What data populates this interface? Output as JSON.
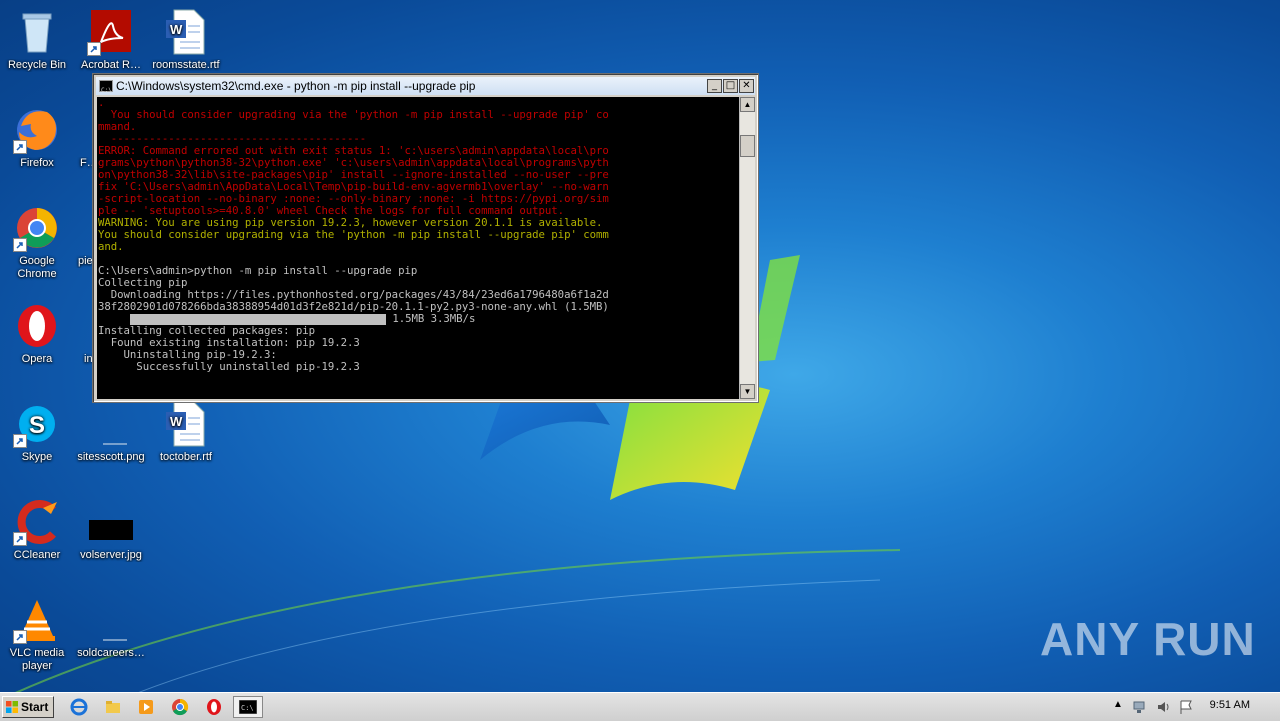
{
  "desktop": {
    "icons": [
      {
        "label": "Recycle Bin",
        "icon": "recycle-bin-icon"
      },
      {
        "label": "Acrobat R…",
        "icon": "acrobat-icon"
      },
      {
        "label": "roomsstate.rtf",
        "icon": "word-doc-icon"
      },
      {
        "label": "Firefox",
        "icon": "firefox-icon"
      },
      {
        "label": "File",
        "icon": "file-icon"
      },
      {
        "label": "Google Chrome",
        "icon": "chrome-icon"
      },
      {
        "label": "pie",
        "icon": "file-icon"
      },
      {
        "label": "Opera",
        "icon": "opera-icon"
      },
      {
        "label": "in",
        "icon": "file-icon"
      },
      {
        "label": "Skype",
        "icon": "skype-icon"
      },
      {
        "label": "sitesscott.png",
        "icon": "image-file-icon"
      },
      {
        "label": "toctober.rtf",
        "icon": "word-doc-icon"
      },
      {
        "label": "CCleaner",
        "icon": "ccleaner-icon"
      },
      {
        "label": "volserver.jpg",
        "icon": "image-file-icon"
      },
      {
        "label": "VLC media player",
        "icon": "vlc-icon"
      },
      {
        "label": "soldcareers…",
        "icon": "image-file-icon"
      }
    ]
  },
  "cmd": {
    "title": "C:\\Windows\\system32\\cmd.exe - python  -m pip install --upgrade pip",
    "lines_red": [
      "  You should consider upgrading via the 'python -m pip install --upgrade pip' co",
      "mmand.",
      "  ----------------------------------------",
      "ERROR: Command errored out with exit status 1: 'c:\\users\\admin\\appdata\\local\\pro",
      "grams\\python\\python38-32\\python.exe' 'c:\\users\\admin\\appdata\\local\\programs\\pyth",
      "on\\python38-32\\lib\\site-packages\\pip' install --ignore-installed --no-user --pre",
      "fix 'C:\\Users\\admin\\AppData\\Local\\Temp\\pip-build-env-agvermb1\\overlay' --no-warn",
      "-script-location --no-binary :none: --only-binary :none: -i https://pypi.org/sim",
      "ple -- 'setuptools>=40.8.0' wheel Check the logs for full command output."
    ],
    "lines_yellow": [
      "WARNING: You are using pip version 19.2.3, however version 20.1.1 is available.",
      "You should consider upgrading via the 'python -m pip install --upgrade pip' comm",
      "and."
    ],
    "lines_white_1": [
      "",
      "C:\\Users\\admin>python -m pip install --upgrade pip",
      "Collecting pip",
      "  Downloading https://files.pythonhosted.org/packages/43/84/23ed6a1796480a6f1a2d",
      "38f2802901d078266bda38388954d01d3f2e821d/pip-20.1.1-py2.py3-none-any.whl (1.5MB)",
      ""
    ],
    "progress_text": "1.5MB 3.3MB/s",
    "progress_fraction": 1.0,
    "lines_white_2": [
      "Installing collected packages: pip",
      "  Found existing installation: pip 19.2.3",
      "    Uninstalling pip-19.2.3:",
      "      Successfully uninstalled pip-19.2.3"
    ]
  },
  "taskbar": {
    "start_label": "Start",
    "clock": "9:51 AM",
    "pinned": [
      "ie-icon",
      "explorer-icon",
      "media-player-icon",
      "chrome-icon",
      "opera-icon",
      "cmd-icon"
    ]
  },
  "watermark": "ANY RUN",
  "colors": {
    "console_red": "#c00000",
    "console_yellow": "#b0b000",
    "console_text": "#c0c0c0",
    "desktop_blue": "#1e7fd0"
  }
}
